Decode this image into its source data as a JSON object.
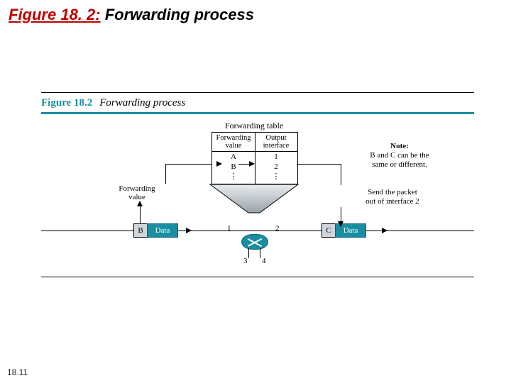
{
  "slide": {
    "figure_number_colored": "Figure 18. 2:",
    "figure_title_rest": " Forwarding process",
    "page_number": "18.11"
  },
  "figure": {
    "caption_number": "Figure 18.2",
    "caption_text": "Forwarding process",
    "forwarding_table_label": "Forwarding table",
    "forwarding_value_side_label_l1": "Forwarding",
    "forwarding_value_side_label_l2": "value",
    "table": {
      "header_left_l1": "Forwarding",
      "header_left_l2": "value",
      "header_right_l1": "Output",
      "header_right_l2": "interface",
      "rows_left": [
        "A",
        "B",
        "⋮"
      ],
      "rows_right": [
        "1",
        "2",
        "⋮"
      ]
    },
    "note": {
      "heading": "Note:",
      "line1": "B and C can be the",
      "line2": "same or different."
    },
    "send": {
      "line1": "Send the packet",
      "line2": "out of interface 2"
    },
    "left_packet": {
      "tag": "B",
      "payload": "Data"
    },
    "right_packet": {
      "tag": "C",
      "payload": "Data"
    },
    "ports": {
      "p1": "1",
      "p2": "2",
      "p3": "3",
      "p4": "4"
    }
  }
}
